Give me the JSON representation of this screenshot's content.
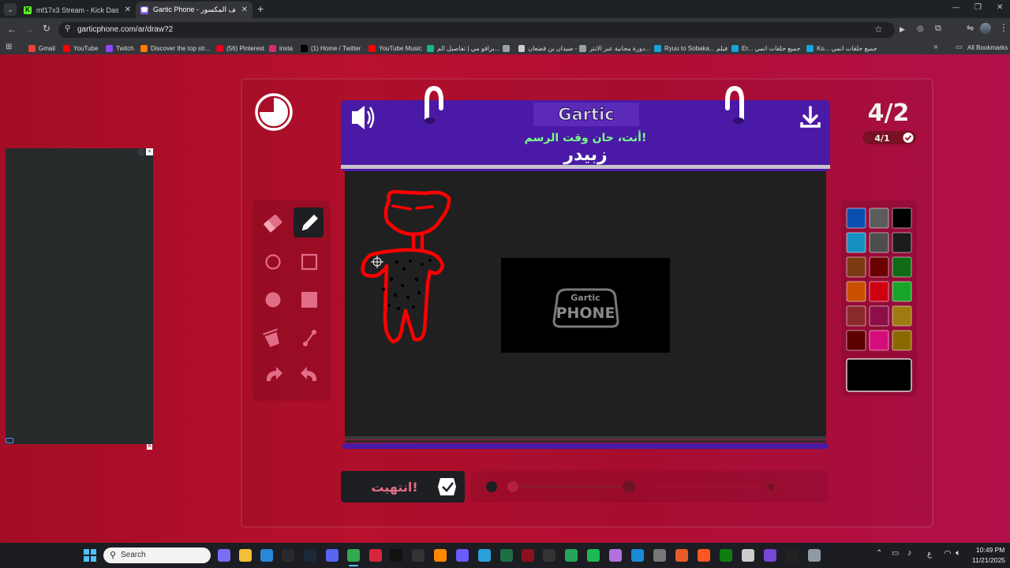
{
  "tabs": [
    {
      "title": "mf17x3 Stream - Kick Dashboar",
      "icon": "kick-icon",
      "active": false
    },
    {
      "title": "Gartic Phone - الهاتف المكسور",
      "icon": "gartic-icon",
      "active": true
    }
  ],
  "new_tab": "+",
  "window_controls": {
    "minimize": "—",
    "restore": "❐",
    "close": "✕"
  },
  "address": {
    "url": "garticphone.com/ar/draw?2"
  },
  "bookmarks": [
    {
      "label": "Gmail",
      "color": "#ea4335"
    },
    {
      "label": "YouTube",
      "color": "#ff0000"
    },
    {
      "label": "Twitch",
      "color": "#9146ff"
    },
    {
      "label": "Discover the top str...",
      "color": "#ff7a00"
    },
    {
      "label": "(56) Pinterest",
      "color": "#e60023"
    },
    {
      "label": "insta",
      "color": "#d62976"
    },
    {
      "label": "(1) Home / Twitter",
      "color": "#000000"
    },
    {
      "label": "YouTube Music",
      "color": "#ff0000"
    },
    {
      "label": "برافو مي | تفاصيل الم...",
      "color": "#1bb28f"
    },
    {
      "label": "",
      "color": "#9aa0a6"
    },
    {
      "label": "ضيدان بن قضعان -...",
      "color": "#cccccc"
    },
    {
      "label": "دورة مجانية عبر الانتر...",
      "color": "#9aa0a6"
    },
    {
      "label": "Ryuu to Sobaka... فيلم",
      "color": "#1aa3d9"
    },
    {
      "label": "Er... جميع حلقات انمي",
      "color": "#1aa3d9"
    },
    {
      "label": "Ku... جميع حلقات انمي",
      "color": "#1aa3d9"
    }
  ],
  "all_bookmarks": "All Bookmarks",
  "game": {
    "logo": "Gartic",
    "subtitle": "أنت، حان وقت الرسم!",
    "word": "زبيدر",
    "round": "4/2",
    "done_count": "4/1",
    "done_button": "انتهيت!",
    "preview_logo_top": "Gartic",
    "preview_logo_bottom": "PHONE"
  },
  "tools": [
    "eraser-icon",
    "pencil-icon",
    "ellipse-outline-icon",
    "rectangle-outline-icon",
    "ellipse-filled-icon",
    "rectangle-filled-icon",
    "bucket-fill-icon",
    "line-icon",
    "undo-icon",
    "redo-icon"
  ],
  "palette": [
    "#0a4fb0",
    "#5c5c5c",
    "#000000",
    "#1491c0",
    "#4e4e4e",
    "#1c1c1c",
    "#7b3a12",
    "#6b0000",
    "#0f6b16",
    "#c85000",
    "#cf0010",
    "#19a52a",
    "#8a2a2a",
    "#8c0f47",
    "#9e7a10",
    "#5c0000",
    "#d40c7c",
    "#8a6a00"
  ],
  "selected_color": "#000000",
  "ad_info": "ⓘ",
  "ad_close": "✕",
  "taskbar": {
    "search": "Search",
    "time": "10:49 PM",
    "date": "11/21/2025",
    "lang": "ع"
  }
}
